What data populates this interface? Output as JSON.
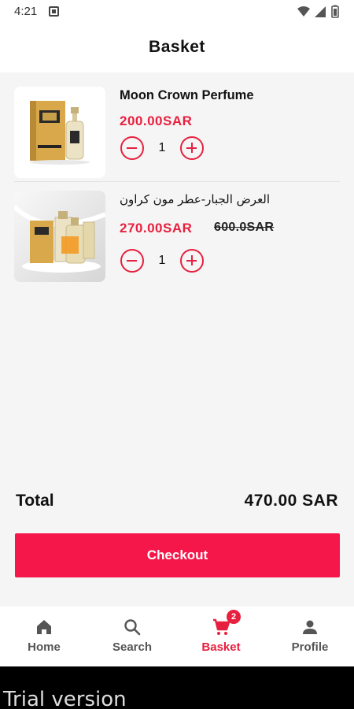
{
  "status": {
    "time": "4:21"
  },
  "appbar": {
    "title": "Basket"
  },
  "items": [
    {
      "name": "Moon Crown Perfume",
      "price": "200.00SAR",
      "old_price": "",
      "qty": "1"
    },
    {
      "name": "العرض الجبار-عطر مون كراون",
      "price": "270.00SAR",
      "old_price": "600.0SAR",
      "qty": "1"
    }
  ],
  "summary": {
    "total_label": "Total",
    "total_value": "470.00 SAR"
  },
  "checkout_label": "Checkout",
  "nav": {
    "home": "Home",
    "search": "Search",
    "basket": "Basket",
    "basket_badge": "2",
    "profile": "Profile"
  },
  "trial": "Trial version",
  "colors": {
    "accent": "#e8203f",
    "button": "#f5174a"
  }
}
